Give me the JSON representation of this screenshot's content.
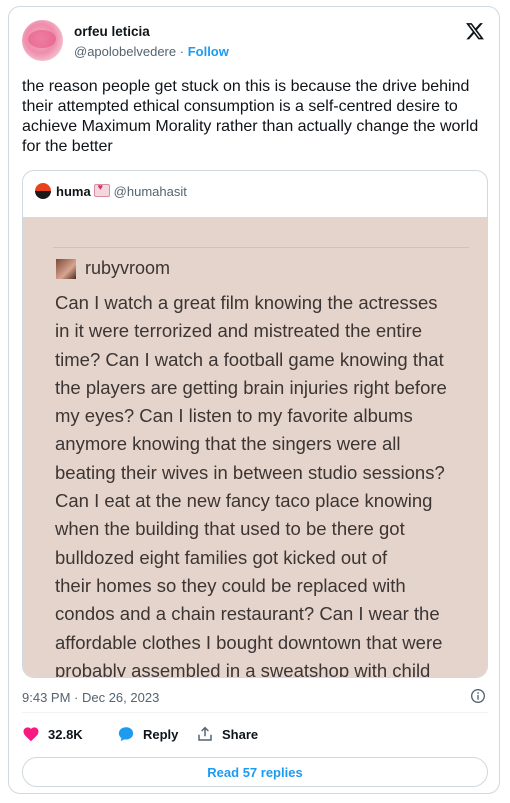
{
  "author": {
    "display_name": "orfeu leticia",
    "handle": "@apolobelvedere",
    "separator": "·",
    "follow_label": "Follow"
  },
  "tweet": {
    "text": "the reason people get stuck on this is because the drive behind their attempted ethical consumption is a self-centred desire to achieve Maximum Morality rather than actually change the world for the better",
    "timestamp": "9:43 PM · Dec 26, 2023"
  },
  "quote": {
    "name": "huma",
    "emoji": "love-letter-emoji",
    "handle": "@humahasit",
    "image": {
      "username": "rubyvroom",
      "body": "Can I watch a great film knowing the actresses\nin it were terrorized and mistreated the entire\ntime? Can I watch a football game knowing that\nthe players are getting brain injuries right before\nmy eyes? Can I listen to my favorite albums\nanymore knowing that the singers were all\nbeating their wives in between studio sessions?\nCan I eat at the new fancy taco place knowing\nwhen the building that used to be there got\nbulldozed eight families got kicked out of\ntheir homes so they could be replaced with\ncondos and a chain restaurant? Can I wear the\naffordable clothes I bought downtown that were\nprobably assembled in a sweatshop with child"
    }
  },
  "actions": {
    "likes": "32.8K",
    "reply_label": "Reply",
    "share_label": "Share",
    "read_replies": "Read 57 replies"
  },
  "colors": {
    "accent": "#1d9bf0",
    "like": "#f91880",
    "text": "#0f1419",
    "secondary": "#536471",
    "border": "#cfd9de"
  },
  "icons": [
    "x-logo-icon",
    "info-icon",
    "heart-icon",
    "reply-bubble-icon",
    "share-icon"
  ]
}
